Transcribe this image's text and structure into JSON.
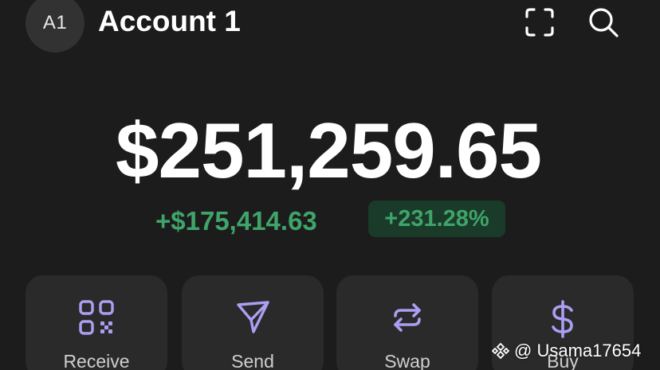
{
  "header": {
    "avatar_initials": "A1",
    "account_name": "Account 1",
    "scan_icon": "scan-icon",
    "search_icon": "search-icon"
  },
  "portfolio": {
    "balance": "$251,259.65",
    "change_amount": "+$175,414.63",
    "change_percent": "+231.28%"
  },
  "actions": [
    {
      "label": "Receive",
      "icon": "qr-code-icon"
    },
    {
      "label": "Send",
      "icon": "send-icon"
    },
    {
      "label": "Swap",
      "icon": "swap-icon"
    },
    {
      "label": "Buy",
      "icon": "dollar-icon"
    }
  ],
  "watermark": {
    "text": "@ Usama17654",
    "logo": "binance-logo"
  },
  "colors": {
    "background": "#1c1c1c",
    "card": "#2a2a2a",
    "positive": "#3fa46a",
    "positive_pill_bg": "#1a3a2a",
    "accent_icon": "#ab9ff2"
  }
}
